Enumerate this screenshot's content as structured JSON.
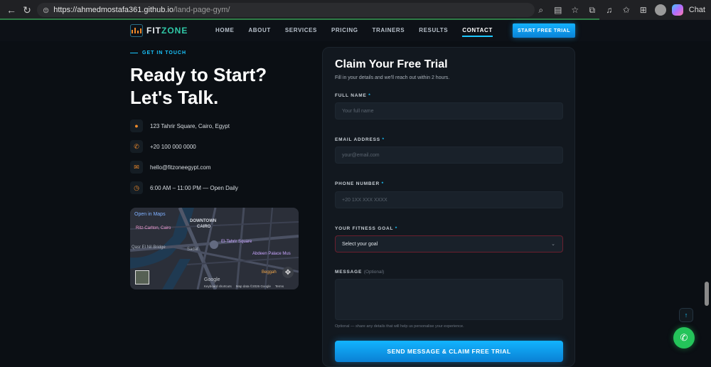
{
  "browser": {
    "url_host": "https://ahmedmostafa361.github.io",
    "url_path": "/land-page-gym/",
    "chat_label": "Chat"
  },
  "header": {
    "logo_main": "FIT",
    "logo_accent": "ZONE",
    "nav": [
      "HOME",
      "ABOUT",
      "SERVICES",
      "PRICING",
      "TRAINERS",
      "RESULTS",
      "CONTACT"
    ],
    "active_nav": "CONTACT",
    "cta": "START FREE TRIAL"
  },
  "contact": {
    "eyebrow": "GET IN TOUCH",
    "headline_1": "Ready to Start?",
    "headline_2": "Let's Talk.",
    "items": [
      {
        "icon": "location-pin-icon",
        "text": "123 Tahrir Square, Cairo, Egypt"
      },
      {
        "icon": "phone-icon",
        "text": "+20 100 000 0000"
      },
      {
        "icon": "mail-icon",
        "text": "hello@fitzoneegypt.com"
      },
      {
        "icon": "clock-icon",
        "text": "6:00 AM – 11:00 PM — Open Daily"
      }
    ]
  },
  "map": {
    "open_link": "Open in Maps",
    "labels": {
      "downtown": "DOWNTOWN",
      "cairo": "CAIRO",
      "ritz": "Ritz-Carlton, Cairo",
      "sadat": "Sadat",
      "el_tahrir": "El-Tahrir Square",
      "abdeen": "Abdeen Palace Mus",
      "qasr": "Qasr El Nil Bridge",
      "beggah": "Beggah"
    },
    "google": "Google",
    "footer": [
      "Keyboard shortcuts",
      "Map data ©2026 Google",
      "Terms"
    ]
  },
  "form": {
    "title": "Claim Your Free Trial",
    "subtitle": "Fill in your details and we'll reach out within 2 hours.",
    "full_name_label": "FULL NAME",
    "full_name_placeholder": "Your full name",
    "email_label": "EMAIL ADDRESS",
    "email_placeholder": "your@email.com",
    "phone_label": "PHONE NUMBER",
    "phone_placeholder": "+20 1XX XXX XXXX",
    "goal_label": "YOUR FITNESS GOAL",
    "goal_value": "Select your goal",
    "message_label": "MESSAGE",
    "message_optional": "(Optional)",
    "help_text": "Optional — share any details that will help us personalise your experience.",
    "submit": "SEND MESSAGE & CLAIM FREE TRIAL"
  }
}
